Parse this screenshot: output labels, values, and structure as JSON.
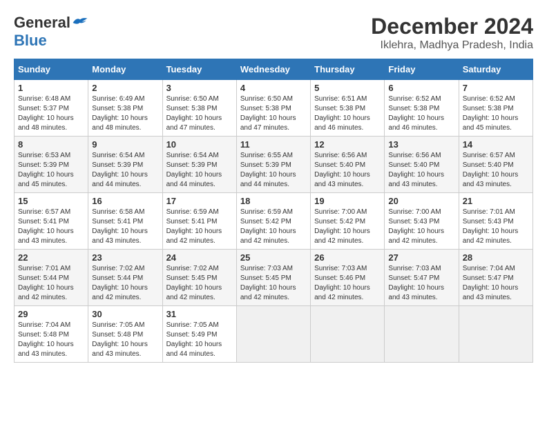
{
  "header": {
    "logo_general": "General",
    "logo_blue": "Blue",
    "title": "December 2024",
    "subtitle": "Iklehra, Madhya Pradesh, India"
  },
  "calendar": {
    "weekdays": [
      "Sunday",
      "Monday",
      "Tuesday",
      "Wednesday",
      "Thursday",
      "Friday",
      "Saturday"
    ],
    "weeks": [
      [
        {
          "day": "",
          "empty": true
        },
        {
          "day": "",
          "empty": true
        },
        {
          "day": "",
          "empty": true
        },
        {
          "day": "",
          "empty": true
        },
        {
          "day": "",
          "empty": true
        },
        {
          "day": "",
          "empty": true
        },
        {
          "day": "",
          "empty": true
        }
      ],
      [
        {
          "day": "1",
          "sunrise": "Sunrise: 6:48 AM",
          "sunset": "Sunset: 5:37 PM",
          "daylight": "Daylight: 10 hours and 48 minutes."
        },
        {
          "day": "2",
          "sunrise": "Sunrise: 6:49 AM",
          "sunset": "Sunset: 5:38 PM",
          "daylight": "Daylight: 10 hours and 48 minutes."
        },
        {
          "day": "3",
          "sunrise": "Sunrise: 6:50 AM",
          "sunset": "Sunset: 5:38 PM",
          "daylight": "Daylight: 10 hours and 47 minutes."
        },
        {
          "day": "4",
          "sunrise": "Sunrise: 6:50 AM",
          "sunset": "Sunset: 5:38 PM",
          "daylight": "Daylight: 10 hours and 47 minutes."
        },
        {
          "day": "5",
          "sunrise": "Sunrise: 6:51 AM",
          "sunset": "Sunset: 5:38 PM",
          "daylight": "Daylight: 10 hours and 46 minutes."
        },
        {
          "day": "6",
          "sunrise": "Sunrise: 6:52 AM",
          "sunset": "Sunset: 5:38 PM",
          "daylight": "Daylight: 10 hours and 46 minutes."
        },
        {
          "day": "7",
          "sunrise": "Sunrise: 6:52 AM",
          "sunset": "Sunset: 5:38 PM",
          "daylight": "Daylight: 10 hours and 45 minutes."
        }
      ],
      [
        {
          "day": "8",
          "sunrise": "Sunrise: 6:53 AM",
          "sunset": "Sunset: 5:39 PM",
          "daylight": "Daylight: 10 hours and 45 minutes."
        },
        {
          "day": "9",
          "sunrise": "Sunrise: 6:54 AM",
          "sunset": "Sunset: 5:39 PM",
          "daylight": "Daylight: 10 hours and 44 minutes."
        },
        {
          "day": "10",
          "sunrise": "Sunrise: 6:54 AM",
          "sunset": "Sunset: 5:39 PM",
          "daylight": "Daylight: 10 hours and 44 minutes."
        },
        {
          "day": "11",
          "sunrise": "Sunrise: 6:55 AM",
          "sunset": "Sunset: 5:39 PM",
          "daylight": "Daylight: 10 hours and 44 minutes."
        },
        {
          "day": "12",
          "sunrise": "Sunrise: 6:56 AM",
          "sunset": "Sunset: 5:40 PM",
          "daylight": "Daylight: 10 hours and 43 minutes."
        },
        {
          "day": "13",
          "sunrise": "Sunrise: 6:56 AM",
          "sunset": "Sunset: 5:40 PM",
          "daylight": "Daylight: 10 hours and 43 minutes."
        },
        {
          "day": "14",
          "sunrise": "Sunrise: 6:57 AM",
          "sunset": "Sunset: 5:40 PM",
          "daylight": "Daylight: 10 hours and 43 minutes."
        }
      ],
      [
        {
          "day": "15",
          "sunrise": "Sunrise: 6:57 AM",
          "sunset": "Sunset: 5:41 PM",
          "daylight": "Daylight: 10 hours and 43 minutes."
        },
        {
          "day": "16",
          "sunrise": "Sunrise: 6:58 AM",
          "sunset": "Sunset: 5:41 PM",
          "daylight": "Daylight: 10 hours and 43 minutes."
        },
        {
          "day": "17",
          "sunrise": "Sunrise: 6:59 AM",
          "sunset": "Sunset: 5:41 PM",
          "daylight": "Daylight: 10 hours and 42 minutes."
        },
        {
          "day": "18",
          "sunrise": "Sunrise: 6:59 AM",
          "sunset": "Sunset: 5:42 PM",
          "daylight": "Daylight: 10 hours and 42 minutes."
        },
        {
          "day": "19",
          "sunrise": "Sunrise: 7:00 AM",
          "sunset": "Sunset: 5:42 PM",
          "daylight": "Daylight: 10 hours and 42 minutes."
        },
        {
          "day": "20",
          "sunrise": "Sunrise: 7:00 AM",
          "sunset": "Sunset: 5:43 PM",
          "daylight": "Daylight: 10 hours and 42 minutes."
        },
        {
          "day": "21",
          "sunrise": "Sunrise: 7:01 AM",
          "sunset": "Sunset: 5:43 PM",
          "daylight": "Daylight: 10 hours and 42 minutes."
        }
      ],
      [
        {
          "day": "22",
          "sunrise": "Sunrise: 7:01 AM",
          "sunset": "Sunset: 5:44 PM",
          "daylight": "Daylight: 10 hours and 42 minutes."
        },
        {
          "day": "23",
          "sunrise": "Sunrise: 7:02 AM",
          "sunset": "Sunset: 5:44 PM",
          "daylight": "Daylight: 10 hours and 42 minutes."
        },
        {
          "day": "24",
          "sunrise": "Sunrise: 7:02 AM",
          "sunset": "Sunset: 5:45 PM",
          "daylight": "Daylight: 10 hours and 42 minutes."
        },
        {
          "day": "25",
          "sunrise": "Sunrise: 7:03 AM",
          "sunset": "Sunset: 5:45 PM",
          "daylight": "Daylight: 10 hours and 42 minutes."
        },
        {
          "day": "26",
          "sunrise": "Sunrise: 7:03 AM",
          "sunset": "Sunset: 5:46 PM",
          "daylight": "Daylight: 10 hours and 42 minutes."
        },
        {
          "day": "27",
          "sunrise": "Sunrise: 7:03 AM",
          "sunset": "Sunset: 5:47 PM",
          "daylight": "Daylight: 10 hours and 43 minutes."
        },
        {
          "day": "28",
          "sunrise": "Sunrise: 7:04 AM",
          "sunset": "Sunset: 5:47 PM",
          "daylight": "Daylight: 10 hours and 43 minutes."
        }
      ],
      [
        {
          "day": "29",
          "sunrise": "Sunrise: 7:04 AM",
          "sunset": "Sunset: 5:48 PM",
          "daylight": "Daylight: 10 hours and 43 minutes."
        },
        {
          "day": "30",
          "sunrise": "Sunrise: 7:05 AM",
          "sunset": "Sunset: 5:48 PM",
          "daylight": "Daylight: 10 hours and 43 minutes."
        },
        {
          "day": "31",
          "sunrise": "Sunrise: 7:05 AM",
          "sunset": "Sunset: 5:49 PM",
          "daylight": "Daylight: 10 hours and 44 minutes."
        },
        {
          "day": "",
          "empty": true
        },
        {
          "day": "",
          "empty": true
        },
        {
          "day": "",
          "empty": true
        },
        {
          "day": "",
          "empty": true
        }
      ]
    ]
  }
}
